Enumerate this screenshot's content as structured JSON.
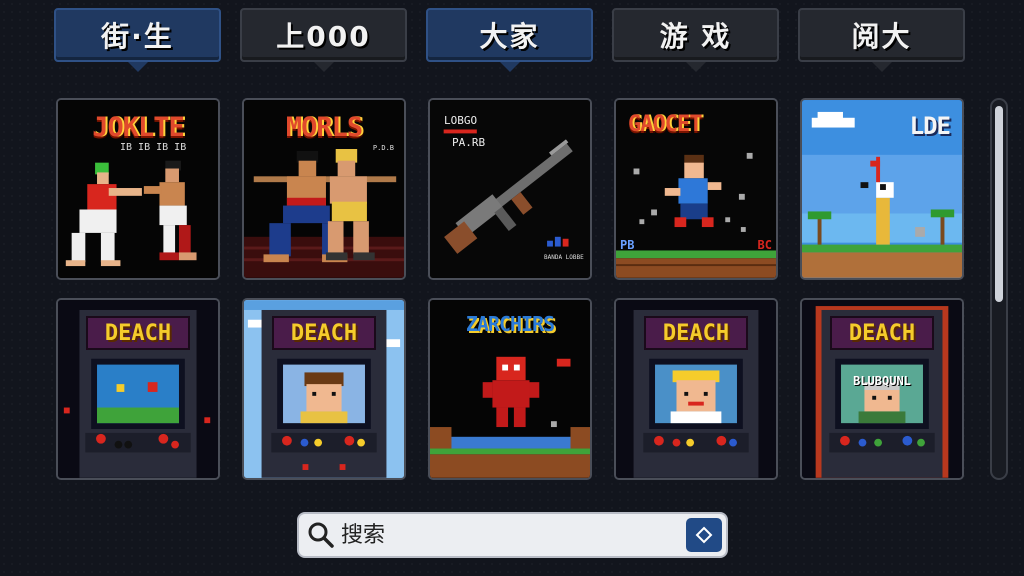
{
  "tabs": [
    {
      "label": "街·生",
      "active": true
    },
    {
      "label": "上000",
      "active": false
    },
    {
      "label": "大家",
      "active": true
    },
    {
      "label": "游 戏",
      "active": false
    },
    {
      "label": "阅大",
      "active": false
    }
  ],
  "games": [
    {
      "title": "JOKLTE",
      "subtitle": "IB IB IB IB"
    },
    {
      "title": "MORLS",
      "subtitle": "P.D.B"
    },
    {
      "title": "LOBGO",
      "subtitle": "PA.RB",
      "footer": "BANDA LOBBE",
      "badge": ".RB"
    },
    {
      "title": "GAOCET",
      "badge_left": "PB",
      "badge_right": "BC"
    },
    {
      "title": "LDE"
    },
    {
      "title": "DEACH"
    },
    {
      "title": "DEACH"
    },
    {
      "title": "ZARCHIRS"
    },
    {
      "title": "DEACH"
    },
    {
      "title": "DEACH",
      "screen_text": "BLUBQUNL"
    }
  ],
  "search": {
    "placeholder": "搜索"
  },
  "colors": {
    "tab_active": "#203961",
    "tab_inactive": "#25282f",
    "accent": "#214a86"
  }
}
